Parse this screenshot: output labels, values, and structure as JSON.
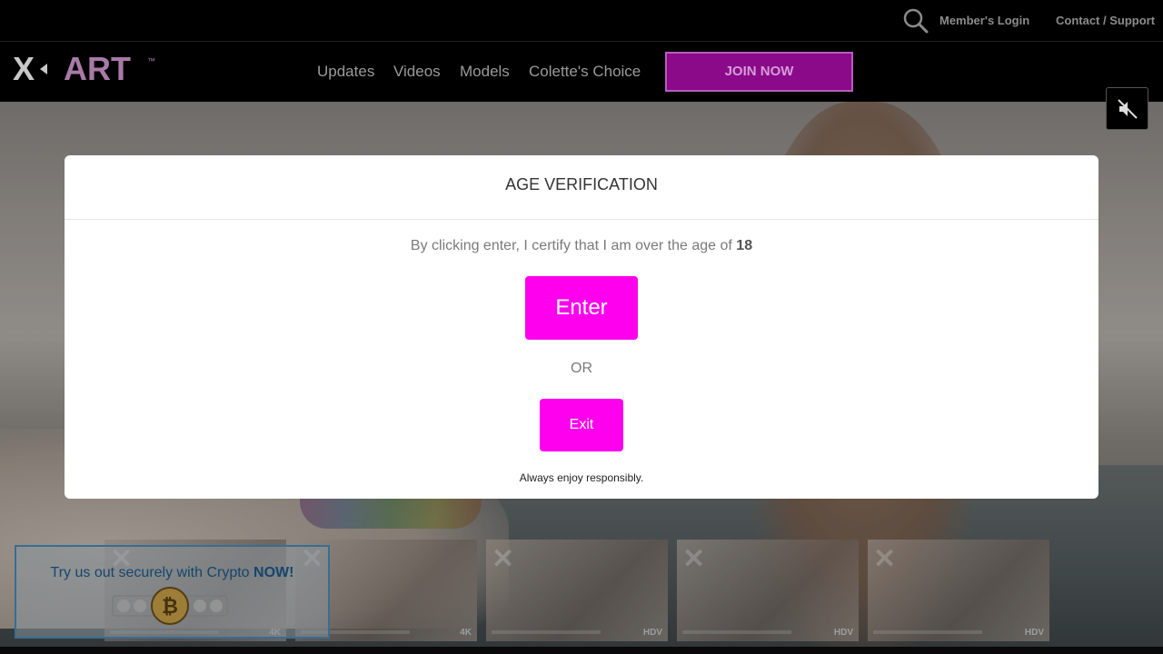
{
  "topbar": {
    "search_icon": "search-icon",
    "login_label": "Member's Login",
    "contact_label": "Contact / Support"
  },
  "navbar": {
    "logo_text": "X-ART™",
    "items": [
      {
        "label": "Updates"
      },
      {
        "label": "Videos"
      },
      {
        "label": "Models"
      },
      {
        "label": "Colette's Choice"
      }
    ],
    "join_label": "JOIN NOW"
  },
  "mute_icon": "speaker-muted-icon",
  "modal": {
    "title": "AGE VERIFICATION",
    "certify_text": "By clicking enter, I certify that I am over the age of ",
    "certify_age": "18",
    "enter_label": "Enter",
    "or_label": "OR",
    "exit_label": "Exit",
    "footer_text": "Always enjoy responsibly."
  },
  "crypto": {
    "message": "Try us out securely with Crypto ",
    "message_bold": "NOW!",
    "icon": "bitcoin-icon"
  },
  "thumbnails": [
    {
      "quality": "4K"
    },
    {
      "quality": "4K"
    },
    {
      "quality": "HDV"
    },
    {
      "quality": "HDV"
    },
    {
      "quality": "HDV"
    }
  ],
  "colors": {
    "accent": "#ff00ee",
    "join_bg": "#8a0a8a",
    "crypto_text": "#1a5a8c"
  }
}
